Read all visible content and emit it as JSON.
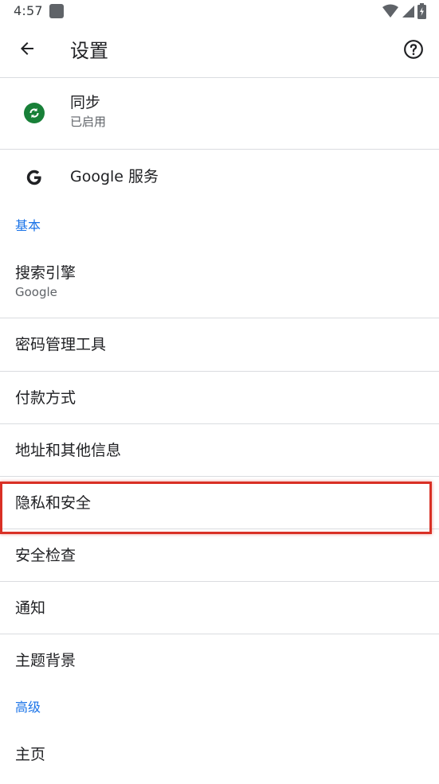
{
  "status_bar": {
    "time": "4:57",
    "icons": [
      "app-icon",
      "wifi-icon",
      "signal-icon",
      "battery-icon"
    ]
  },
  "app_bar": {
    "title": "设置",
    "back_icon": "arrow-back-icon",
    "help_icon": "help-icon"
  },
  "sync": {
    "title": "同步",
    "subtitle": "已启用",
    "icon": "sync-icon"
  },
  "google_services": {
    "title": "Google 服务",
    "icon": "google-icon"
  },
  "sections": {
    "basic": "基本",
    "advanced": "高级"
  },
  "items": {
    "search_engine": {
      "title": "搜索引擎",
      "subtitle": "Google"
    },
    "passwords": {
      "title": "密码管理工具"
    },
    "payment": {
      "title": "付款方式"
    },
    "addresses": {
      "title": "地址和其他信息"
    },
    "privacy": {
      "title": "隐私和安全"
    },
    "safety_check": {
      "title": "安全检查"
    },
    "notifications": {
      "title": "通知"
    },
    "themes": {
      "title": "主题背景"
    },
    "homepage": {
      "title": "主页"
    }
  },
  "colors": {
    "accent": "#1a73e8",
    "sync_green": "#188038",
    "highlight_red": "#d93025"
  }
}
